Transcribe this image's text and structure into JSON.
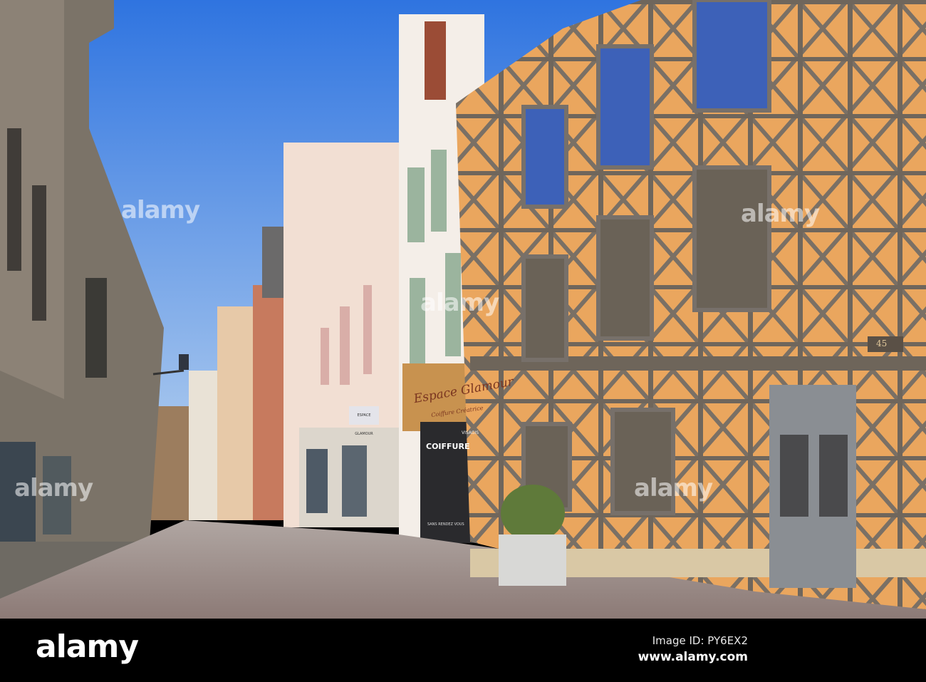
{
  "photo": {
    "shop_sign": "Espace Glamour",
    "shop_subtitle": "Coiffure Créatrice",
    "hanging_sign": "ESPACE GLAMOUR",
    "window_text": "COIFFURE",
    "window_text_small": "VISAGIS",
    "door_text": "SANS RENDEZ VOUS",
    "house_number": "45"
  },
  "watermark": {
    "text": "alamy",
    "image_id": "Image ID: PY6EX2",
    "url": "www.alamy.com"
  },
  "colors": {
    "sky": "#3d7fe0",
    "timber_facade": "#e9a35a",
    "timber": "#6e655a",
    "pavement": "#9a8a85"
  }
}
